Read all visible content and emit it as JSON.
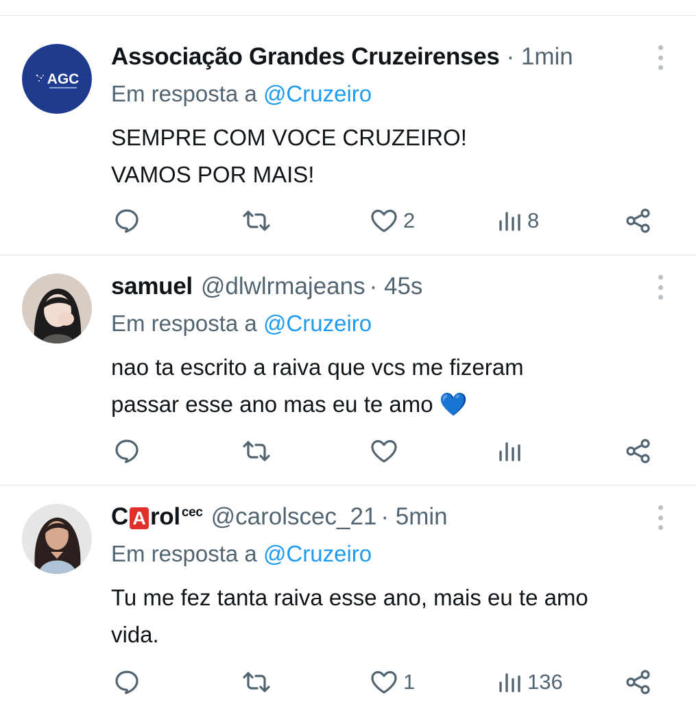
{
  "tweets": [
    {
      "name": "Associação Grandes Cruzeirenses",
      "handle": "",
      "time": "· 1min",
      "reply_prefix": "Em resposta a",
      "reply_to": "@Cruzeiro",
      "lines": [
        "SEMPRE COM VOCE CRUZEIRO!",
        "VAMOS POR MAIS!"
      ],
      "likes": "2",
      "views": "8",
      "avatar_logo_text": "AGC"
    },
    {
      "name": "samuel",
      "handle": "@dlwlrmajeans",
      "time": "· 45s",
      "reply_prefix": "Em resposta a",
      "reply_to": "@Cruzeiro",
      "lines": [
        "nao ta escrito a raiva que vcs me fizeram",
        "passar esse ano mas eu te amo 💙"
      ],
      "likes": "",
      "views": ""
    },
    {
      "name_part1": "C",
      "name_badge": "A",
      "name_part2": "rol",
      "name_sup": "cec",
      "handle": "@carolscec_21",
      "time": "· 5min",
      "reply_prefix": "Em resposta a",
      "reply_to": "@Cruzeiro",
      "lines": [
        "Tu me fez tanta raiva esse ano, mais eu te amo",
        "vida."
      ],
      "likes": "1",
      "views": "136"
    }
  ],
  "icons": {
    "reply": "reply-icon",
    "retweet": "retweet-icon",
    "like": "heart-icon",
    "views": "views-icon",
    "share": "share-icon",
    "more": "more-icon"
  },
  "colors": {
    "link": "#1d9bf0",
    "muted": "#536471",
    "text": "#0f1419",
    "agc_blue": "#1f3b8e"
  }
}
